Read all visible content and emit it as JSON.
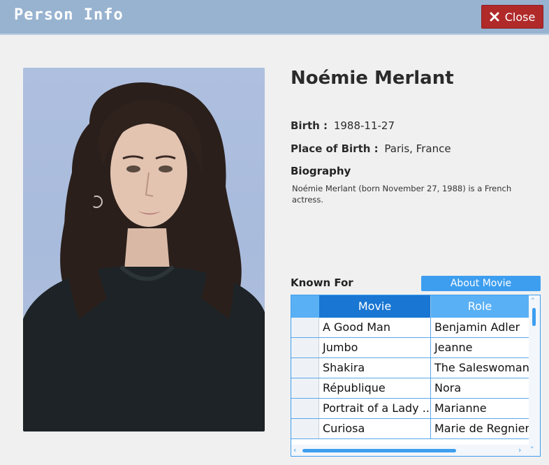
{
  "window": {
    "title": "Person Info",
    "close_label": "Close"
  },
  "person": {
    "name": "Noémie Merlant",
    "birth_label": "Birth :",
    "birth_value": "1988-11-27",
    "place_label": "Place of Birth :",
    "place_value": "Paris, France",
    "biography_label": "Biography",
    "biography": "Noémie Merlant (born November 27, 1988) is a French actress."
  },
  "known_for": {
    "label": "Known For",
    "about_button": "About Movie",
    "columns": [
      "Movie",
      "Role"
    ],
    "rows": [
      {
        "movie": "A Good Man",
        "role": "Benjamin Adler"
      },
      {
        "movie": "Jumbo",
        "role": "Jeanne"
      },
      {
        "movie": "Shakira",
        "role": "The Saleswoman"
      },
      {
        "movie": "République",
        "role": "Nora"
      },
      {
        "movie": "Portrait of a Lady ...",
        "role": "Marianne"
      },
      {
        "movie": "Curiosa",
        "role": "Marie de Regnier"
      }
    ]
  },
  "colors": {
    "titlebar": "#98b3d0",
    "close_button": "#b02a2a",
    "accent": "#3d9ef0",
    "header_selected": "#1976d2"
  },
  "icons": {
    "close": "x-icon"
  }
}
